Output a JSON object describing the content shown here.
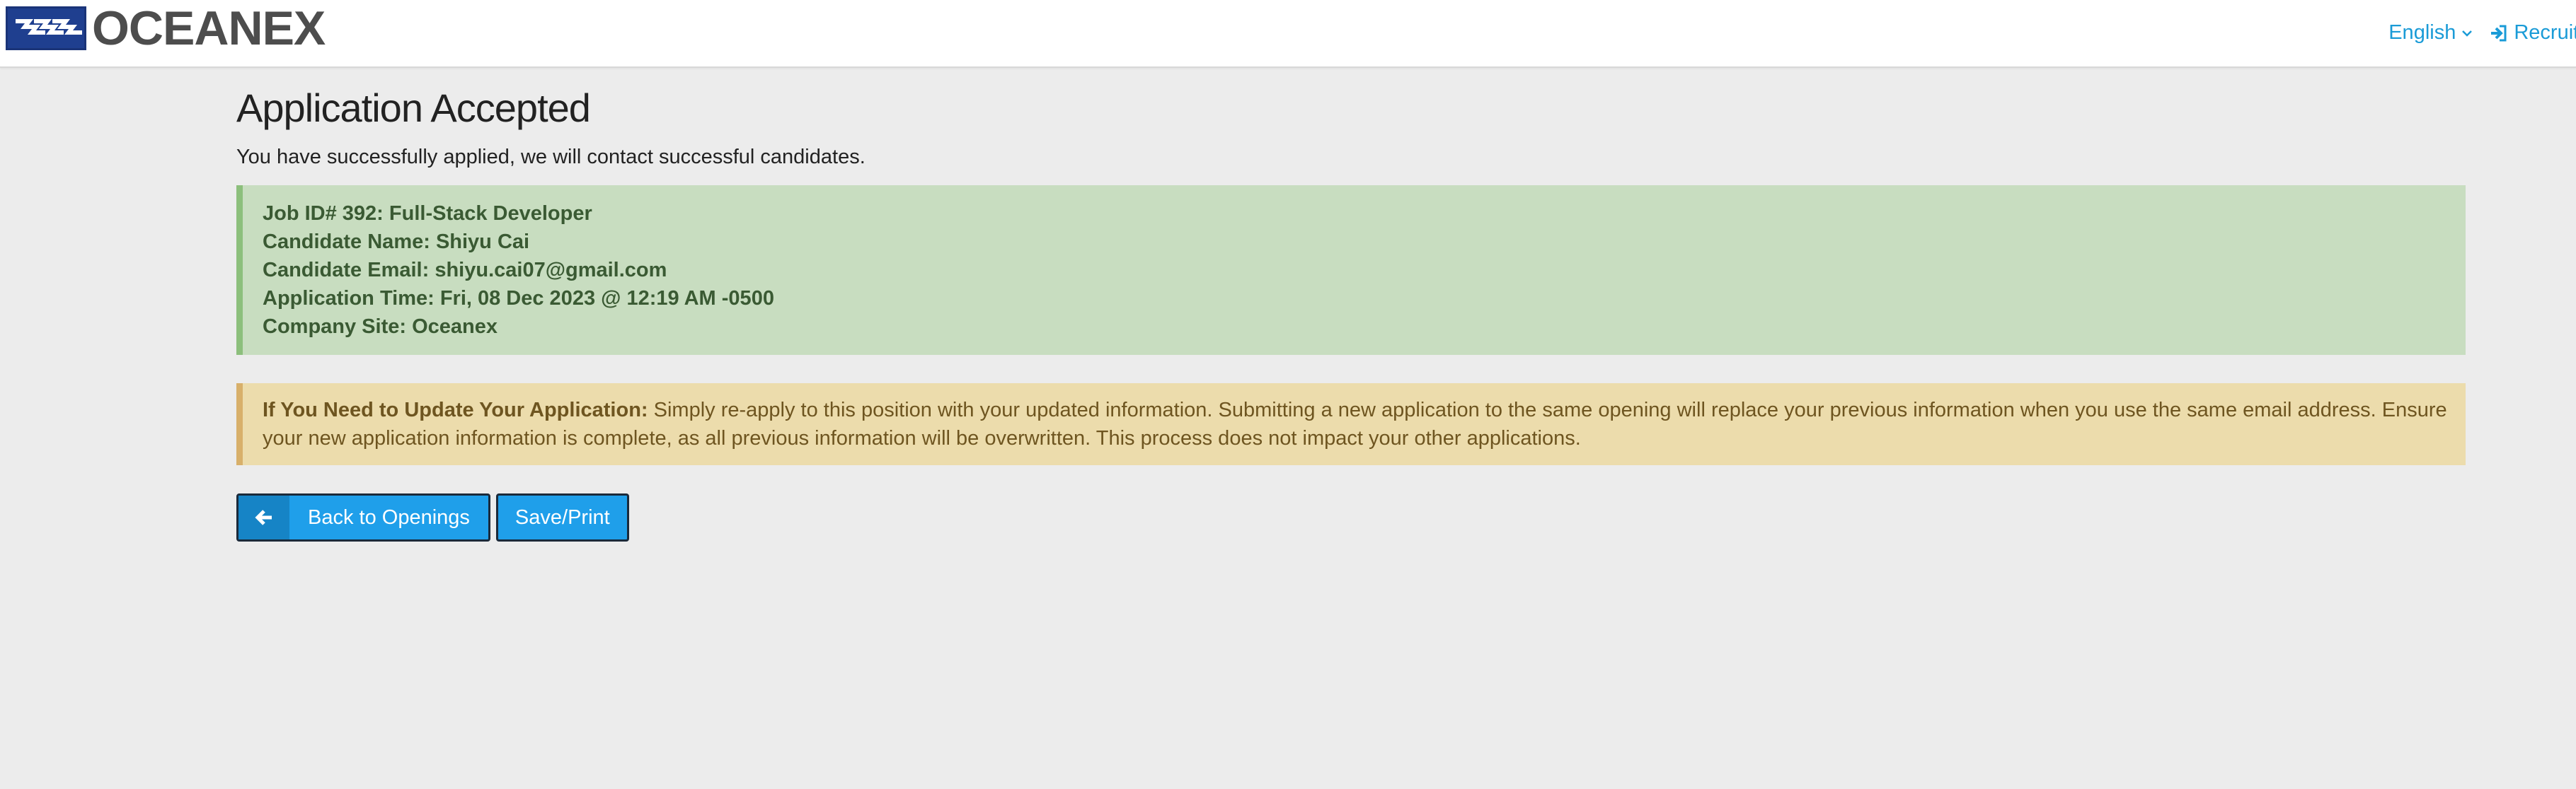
{
  "header": {
    "brand": "OCEANEX",
    "language": "English",
    "recruiter_link": "Recruiter"
  },
  "main": {
    "title": "Application Accepted",
    "subtitle": "You have successfully applied, we will contact successful candidates.",
    "details": [
      "Job ID# 392: Full-Stack Developer",
      "Candidate Name: Shiyu Cai",
      "Candidate Email: shiyu.cai07@gmail.com",
      "Application Time: Fri, 08 Dec 2023 @ 12:19 AM -0500",
      "Company Site: Oceanex"
    ],
    "notice_heading": "If You Need to Update Your Application:",
    "notice_text": " Simply re-apply to this position with your updated information. Submitting a new application to the same opening will replace your previous information when you use the same email address. Ensure your new application information is complete, as all previous information will be overwritten. This process does not impact your other applications.",
    "back_button": "Back to Openings",
    "save_button": "Save/Print"
  },
  "colors": {
    "accent": "#1a9bd7",
    "success_bg": "#c8ddc0",
    "warning_bg": "#ecdcac",
    "button": "#1f9fea"
  },
  "icons": [
    "logo-waves-icon",
    "chevron-down-icon",
    "sign-in-icon",
    "arrow-left-icon"
  ]
}
